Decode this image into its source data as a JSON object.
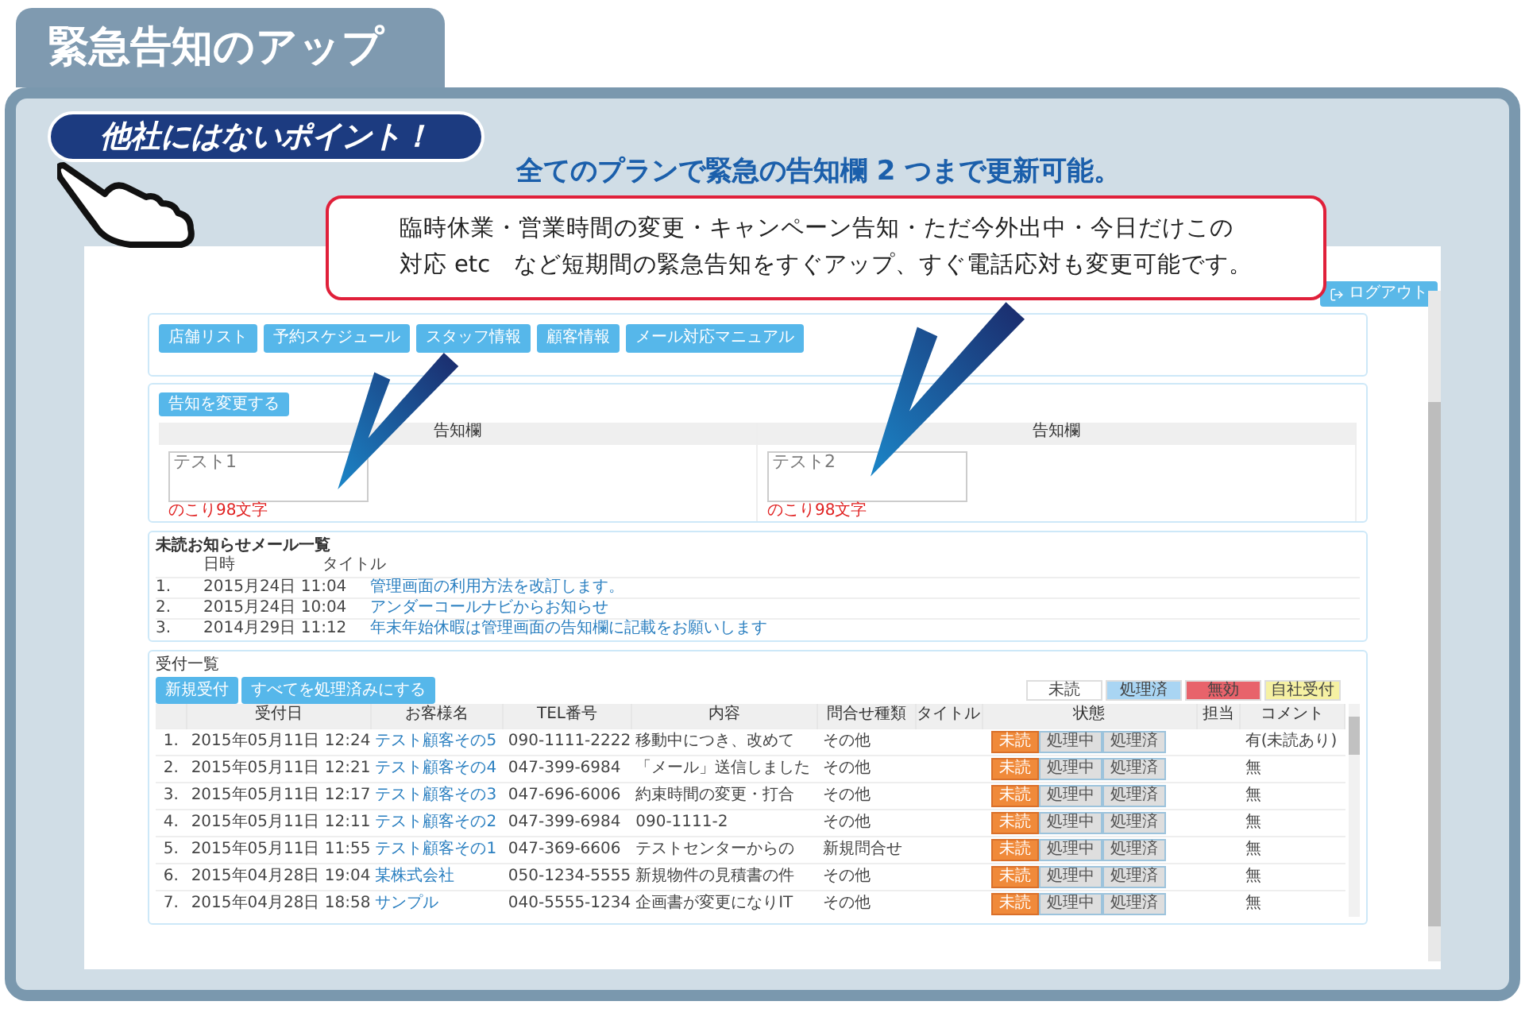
{
  "page_tab": {
    "title": "緊急告知のアップ"
  },
  "badge": {
    "label": "他社にはないポイント！"
  },
  "headline": "全てのプランで緊急の告知欄 2 つまで更新可能。",
  "callout": {
    "lines": [
      "臨時休業・営業時間の変更・キャンペーン告知・ただ今外出中・今日だけこの",
      "対応 etc　など短期間の緊急告知をすぐアップ、すぐ電話応対も変更可能です。"
    ]
  },
  "screen": {
    "logout_button": "ログアウト",
    "nav_buttons": [
      "店舗リスト",
      "予約スケジュール",
      "スタッフ情報",
      "顧客情報",
      "メール対応マニュアル"
    ],
    "notice": {
      "button": "告知を変更する",
      "fields": [
        {
          "header": "告知欄",
          "value": "テスト1",
          "counter": "のこり98文字"
        },
        {
          "header": "告知欄",
          "value": "テスト2",
          "counter": "のこり98文字"
        }
      ]
    },
    "mail_list": {
      "title": "未読お知らせメール一覧",
      "columns": [
        "日時",
        "タイトル"
      ],
      "rows": [
        {
          "number": "1.",
          "date": "2015月24日 11:04",
          "title": "管理画面の利用方法を改訂します。"
        },
        {
          "number": "2.",
          "date": "2015月24日 10:04",
          "title": "アンダーコールナビからお知らせ"
        },
        {
          "number": "3.",
          "date": "2014月29日 11:12",
          "title": "年末年始休暇は管理画面の告知欄に記載をお願いします"
        }
      ]
    },
    "reception": {
      "title": "受付一覧",
      "buttons": [
        "新規受付",
        "すべてを処理済みにする"
      ],
      "legend": [
        {
          "label": "未読",
          "color": "#ffffff"
        },
        {
          "label": "処理済",
          "color": "#a9d5f3"
        },
        {
          "label": "無効",
          "color": "#e8636b"
        },
        {
          "label": "自社受付",
          "color": "#f6f1a3"
        }
      ],
      "columns": [
        "",
        "受付日",
        "お客様名",
        "TEL番号",
        "内容",
        "問合せ種類",
        "タイトル",
        "状態",
        "担当",
        "コメント"
      ],
      "rows": [
        {
          "number": "1.",
          "date": "2015年05月11日 12:24",
          "customer": "テスト顧客その5",
          "tel": "090-1111-2222",
          "content": "移動中につき、改めて",
          "type": "その他",
          "status": [
            {
              "label": "未読",
              "selected": true
            },
            {
              "label": "処理中",
              "selected": false
            },
            {
              "label": "処理済",
              "selected": false
            }
          ],
          "comment": "有(未読あり)"
        },
        {
          "number": "2.",
          "date": "2015年05月11日 12:21",
          "customer": "テスト顧客その4",
          "tel": "047-399-6984",
          "content": "「メール」送信しました",
          "type": "その他",
          "status": [
            {
              "label": "未読",
              "selected": true
            },
            {
              "label": "処理中",
              "selected": false
            },
            {
              "label": "処理済",
              "selected": false
            }
          ],
          "comment": "無"
        },
        {
          "number": "3.",
          "date": "2015年05月11日 12:17",
          "customer": "テスト顧客その3",
          "tel": "047-696-6006",
          "content": "約束時間の変更・打合",
          "type": "その他",
          "status": [
            {
              "label": "未読",
              "selected": true
            },
            {
              "label": "処理中",
              "selected": false
            },
            {
              "label": "処理済",
              "selected": false
            }
          ],
          "comment": "無"
        },
        {
          "number": "4.",
          "date": "2015年05月11日 12:11",
          "customer": "テスト顧客その2",
          "tel": "047-399-6984",
          "content": "090-1111-2",
          "type": "その他",
          "status": [
            {
              "label": "未読",
              "selected": true
            },
            {
              "label": "処理中",
              "selected": false
            },
            {
              "label": "処理済",
              "selected": false
            }
          ],
          "comment": "無"
        },
        {
          "number": "5.",
          "date": "2015年05月11日 11:55",
          "customer": "テスト顧客その1",
          "tel": "047-369-6606",
          "content": "テストセンターからの",
          "type": "新規問合せ",
          "status": [
            {
              "label": "未読",
              "selected": true
            },
            {
              "label": "処理中",
              "selected": false
            },
            {
              "label": "処理済",
              "selected": false
            }
          ],
          "comment": "無"
        },
        {
          "number": "6.",
          "date": "2015年04月28日 19:04",
          "customer": "某株式会社",
          "tel": "050-1234-5555",
          "content": "新規物件の見積書の件",
          "type": "その他",
          "status": [
            {
              "label": "未読",
              "selected": true
            },
            {
              "label": "処理中",
              "selected": false
            },
            {
              "label": "処理済",
              "selected": false
            }
          ],
          "comment": "無"
        },
        {
          "number": "7.",
          "date": "2015年04月28日 18:58",
          "customer": "サンプル",
          "tel": "040-5555-1234",
          "content": "企画書が変更になりIT",
          "type": "その他",
          "status": [
            {
              "label": "未読",
              "selected": true
            },
            {
              "label": "処理中",
              "selected": false
            },
            {
              "label": "処理済",
              "selected": false
            }
          ],
          "comment": "無"
        }
      ]
    }
  }
}
